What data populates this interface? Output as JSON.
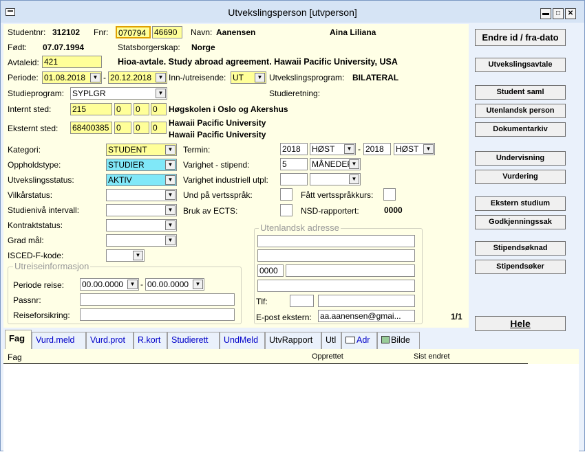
{
  "window": {
    "title": "Utvekslingsperson  [utvperson]"
  },
  "header": {
    "studentnr_label": "Studentnr:",
    "studentnr": "312102",
    "fnr_label": "Fnr:",
    "fnr_date": "070794",
    "fnr_pnr": "46690",
    "navn_label": "Navn:",
    "etternavn": "Aanensen",
    "fornavn": "Aina Liliana",
    "fodt_label": "Født:",
    "fodt": "07.07.1994",
    "statsborgerskap_label": "Statsborgerskap:",
    "statsborgerskap": "Norge"
  },
  "avtale": {
    "label": "Avtaleid:",
    "id": "421",
    "text": "Hioa-avtale. Study abroad agreement. Hawaii Pacific University, USA"
  },
  "periode": {
    "label": "Periode:",
    "fra": "01.08.2018",
    "til": "20.12.2018",
    "inn_ut_label": "Inn-/utreisende:",
    "inn_ut": "UT",
    "program_label": "Utvekslingsprogram:",
    "program": "BILATERAL"
  },
  "studieprogram": {
    "label": "Studieprogram:",
    "value": "SYPLGR",
    "retning_label": "Studieretning:"
  },
  "internt_sted": {
    "label": "Internt sted:",
    "codes": [
      "215",
      "0",
      "0",
      "0"
    ],
    "name": "Høgskolen i Oslo og Akershus"
  },
  "eksternt_sted": {
    "label": "Eksternt sted:",
    "codes": [
      "68400385",
      "0",
      "0",
      "0"
    ],
    "name1": "Hawaii Pacific University",
    "name2": "Hawaii Pacific University"
  },
  "left_fields": {
    "kategori_label": "Kategori:",
    "kategori": "STUDENT",
    "oppholdstype_label": "Oppholdstype:",
    "oppholdstype": "STUDIER",
    "status_label": "Utvekslingsstatus:",
    "status": "AKTIV",
    "vilkar_label": "Vilkårstatus:",
    "studieniva_label": "Studienivå intervall:",
    "kontrakt_label": "Kontraktstatus:",
    "grad_label": "Grad mål:",
    "isced_label": "ISCED-F-kode:"
  },
  "right_fields": {
    "termin_label": "Termin:",
    "termin_fra_ar": "2018",
    "termin_fra": "HØST",
    "termin_til_ar": "2018",
    "termin_til": "HØST",
    "varighet_label": "Varighet - stipend:",
    "varighet": "5",
    "varighet_enhet": "MÅNEDER",
    "industri_label": "Varighet industriell utpl:",
    "und_label": "Und på vertsspråk:",
    "fatt_label": "Fått vertsspråkkurs:",
    "ects_label": "Bruk av ECTS:",
    "nsd_label": "NSD-rapportert:",
    "nsd": "0000"
  },
  "utreise": {
    "title": "Utreiseinformasjon",
    "periode_label": "Periode reise:",
    "fra": "00.00.0000",
    "til": "00.00.0000",
    "passnr_label": "Passnr:",
    "forsikring_label": "Reiseforsikring:"
  },
  "adresse": {
    "title": "Utenlandsk adresse",
    "postnr": "0000",
    "tlf_label": "Tlf:",
    "epost_label": "E-post ekstern:",
    "epost": "aa.aanensen@gmai...",
    "record": "1/1"
  },
  "buttons": [
    "Endre id / fra-dato",
    "Utvekslingsavtale",
    "Student saml",
    "Utenlandsk person",
    "Dokumentarkiv",
    "Undervisning",
    "Vurdering",
    "Ekstern studium",
    "Godkjenningssak",
    "Stipendsøknad",
    "Stipendsøker",
    "Hele"
  ],
  "tabs": [
    "Fag",
    "Vurd.meld",
    "Vurd.prot",
    "R.kort",
    "Studierett",
    "UndMeld",
    "UtvRapport",
    "Utl",
    "Adr",
    "Bilde"
  ],
  "table": {
    "columns": [
      "Fag",
      "Opprettet",
      "Sist endret"
    ]
  }
}
